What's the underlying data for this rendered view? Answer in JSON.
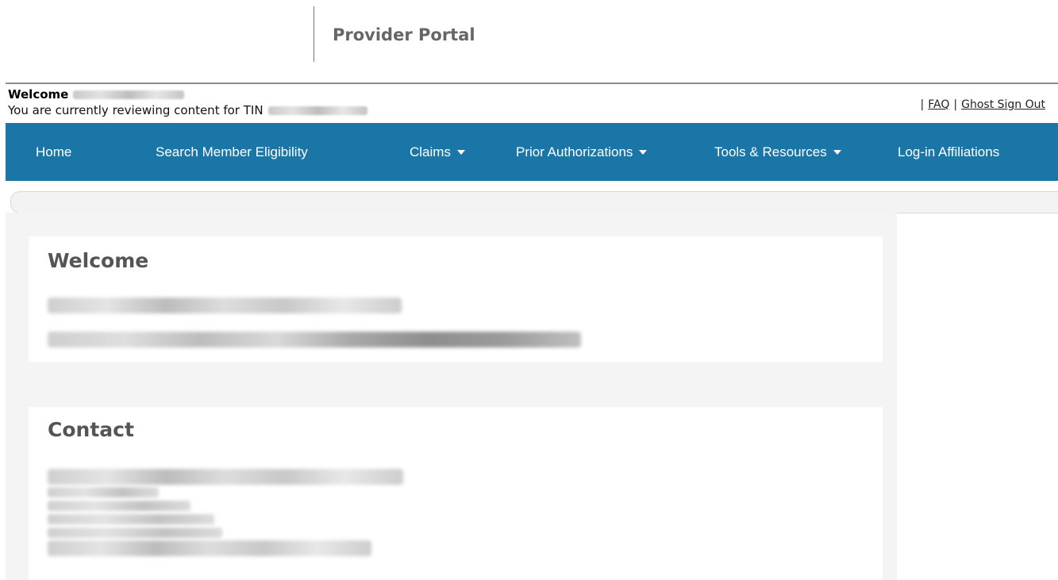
{
  "header": {
    "portal_title": "Provider Portal"
  },
  "user_bar": {
    "welcome_label": "Welcome",
    "tin_label": "You are currently reviewing content for TIN",
    "links": {
      "faq": "FAQ",
      "sign_out": "Ghost Sign Out"
    }
  },
  "nav": {
    "items": [
      {
        "label": "Home",
        "dropdown": false
      },
      {
        "label": "Search Member Eligibility",
        "dropdown": false
      },
      {
        "label": "Claims",
        "dropdown": true
      },
      {
        "label": "Prior Authorizations",
        "dropdown": true
      },
      {
        "label": "Tools & Resources",
        "dropdown": true
      },
      {
        "label": "Log-in Affiliations",
        "dropdown": false
      }
    ]
  },
  "main": {
    "welcome_title": "Welcome",
    "contact_title": "Contact"
  },
  "colors": {
    "nav_background": "#1b76a8",
    "panel_title": "#555555",
    "content_background": "#f4f4f4"
  }
}
